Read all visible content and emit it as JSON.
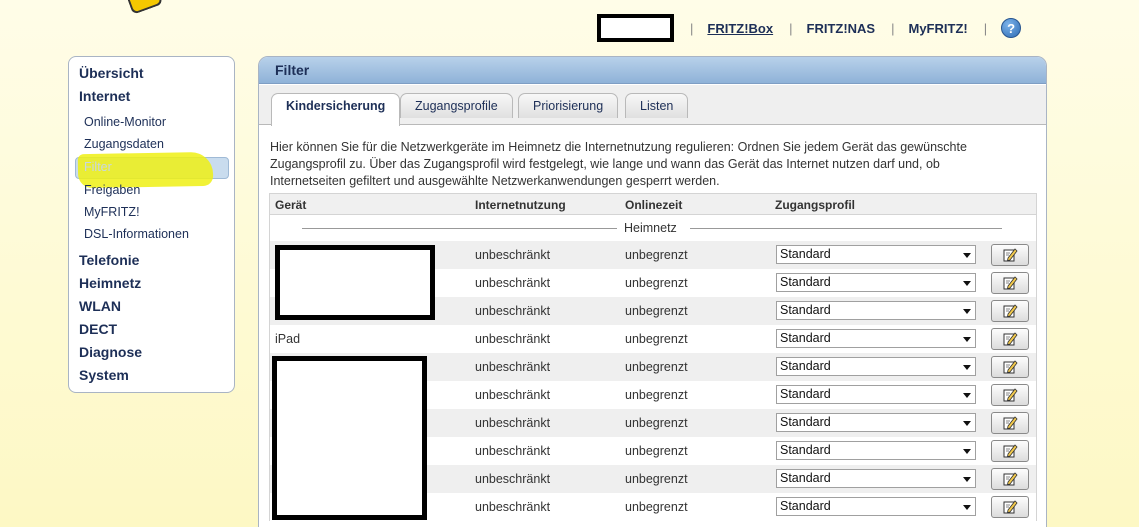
{
  "topnav": {
    "links": [
      "FRITZ!Box",
      "FRITZ!NAS",
      "MyFRITZ!"
    ],
    "separator": "|",
    "help_label": "?"
  },
  "sidebar": {
    "main_items": [
      "Übersicht",
      "Internet",
      "Telefonie",
      "Heimnetz",
      "WLAN",
      "DECT",
      "Diagnose",
      "System"
    ],
    "sub_items": [
      "Online-Monitor",
      "Zugangsdaten",
      "Filter",
      "Freigaben",
      "MyFRITZ!",
      "DSL-Informationen"
    ],
    "active_sub": "Filter"
  },
  "panel": {
    "title": "Filter",
    "tabs": [
      "Kindersicherung",
      "Zugangsprofile",
      "Priorisierung",
      "Listen"
    ],
    "active_tab": "Kindersicherung",
    "description": "Hier können Sie für die Netzwerkgeräte im Heimnetz die Internetnutzung regulieren: Ordnen Sie jedem Gerät das gewünschte Zugangsprofil zu. Über das Zugangsprofil wird festgelegt, wie lange und wann das Gerät das Internet nutzen darf und, ob Internetseiten gefiltert und ausgewählte Netzwerkanwendungen gesperrt werden."
  },
  "table": {
    "headers": [
      "Gerät",
      "Internetnutzung",
      "Onlinezeit",
      "Zugangsprofil"
    ],
    "group": "Heimnetz",
    "rows": [
      {
        "device": "",
        "usage": "unbeschränkt",
        "time": "unbegrenzt",
        "profile": "Standard"
      },
      {
        "device": "",
        "usage": "unbeschränkt",
        "time": "unbegrenzt",
        "profile": "Standard"
      },
      {
        "device": "",
        "usage": "unbeschränkt",
        "time": "unbegrenzt",
        "profile": "Standard"
      },
      {
        "device": "iPad",
        "usage": "unbeschränkt",
        "time": "unbegrenzt",
        "profile": "Standard"
      },
      {
        "device": "",
        "usage": "unbeschränkt",
        "time": "unbegrenzt",
        "profile": "Standard"
      },
      {
        "device": "",
        "usage": "unbeschränkt",
        "time": "unbegrenzt",
        "profile": "Standard"
      },
      {
        "device": "",
        "usage": "unbeschränkt",
        "time": "unbegrenzt",
        "profile": "Standard"
      },
      {
        "device": "",
        "usage": "unbeschränkt",
        "time": "unbegrenzt",
        "profile": "Standard"
      },
      {
        "device": "",
        "usage": "unbeschränkt",
        "time": "unbegrenzt",
        "profile": "Standard"
      },
      {
        "device": "",
        "usage": "unbeschränkt",
        "time": "unbegrenzt",
        "profile": "Standard"
      }
    ]
  },
  "colors": {
    "highlight": "#eef014",
    "panel_header": "#8fb2d8",
    "link": "#1d2f57"
  }
}
